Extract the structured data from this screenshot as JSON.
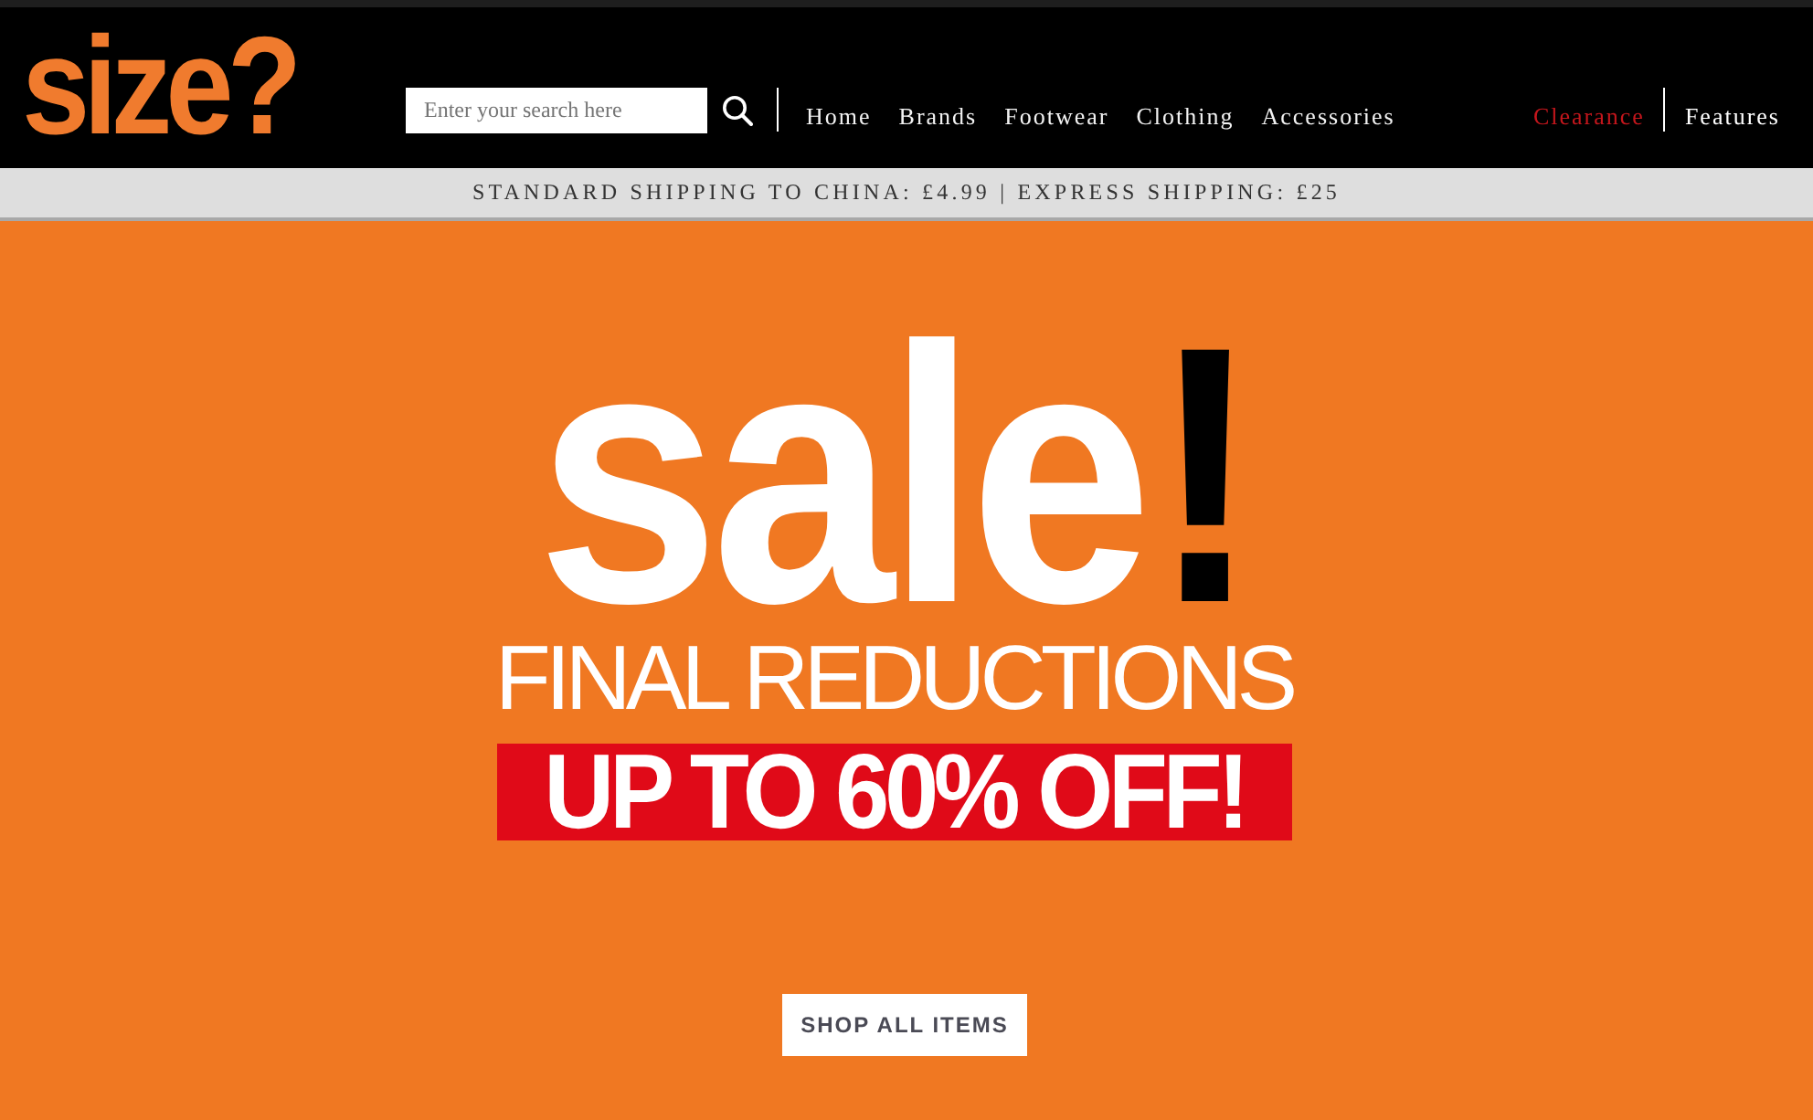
{
  "header": {
    "logo": "size?",
    "search": {
      "placeholder": "Enter your search here"
    },
    "nav": [
      "Home",
      "Brands",
      "Footwear",
      "Clothing",
      "Accessories"
    ],
    "secondary_nav": [
      {
        "label": "Clearance",
        "color": "#c4161c"
      },
      {
        "label": "Features",
        "color": "#ffffff"
      }
    ]
  },
  "shipping_bar": {
    "text": "STANDARD SHIPPING TO CHINA: £4.99 | EXPRESS SHIPPING: £25"
  },
  "banner": {
    "headline": "sale",
    "headline_mark": "!",
    "subtitle": "FINAL REDUCTIONS",
    "offer": "UP TO 60% OFF!",
    "button": "SHOP ALL ITEMS"
  }
}
